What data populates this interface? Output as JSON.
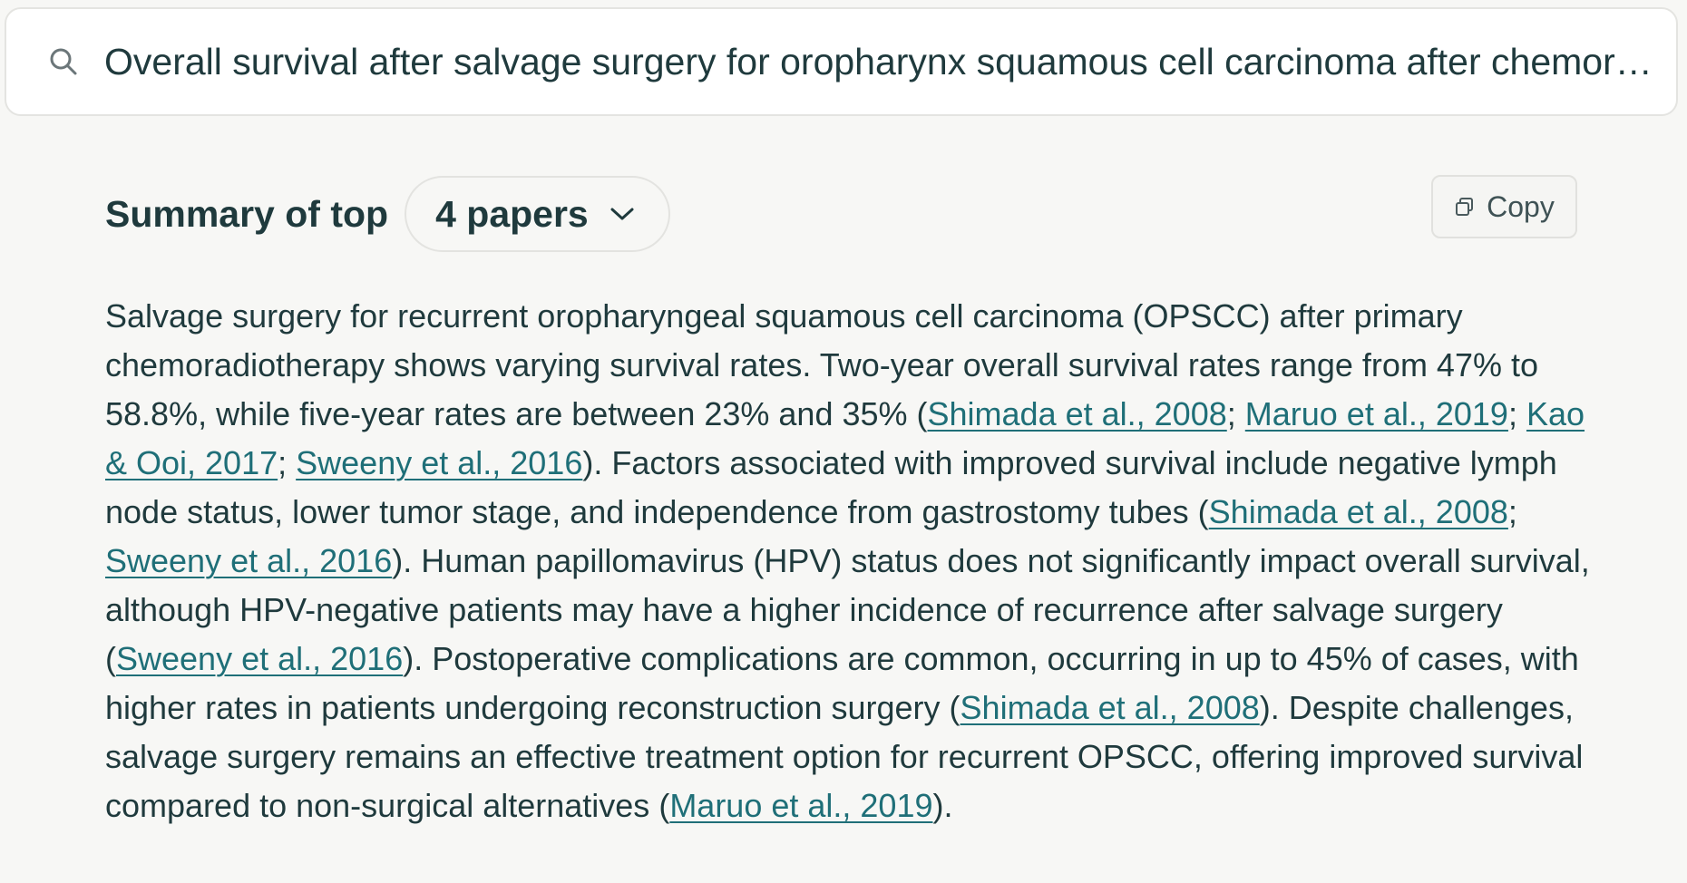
{
  "search": {
    "value": "Overall survival after salvage surgery for oropharynx squamous cell carcinoma after chemoradiotherapy",
    "placeholder": ""
  },
  "summary": {
    "title": "Summary of top",
    "papers_dropdown_label": "4 papers",
    "copy_label": "Copy",
    "body": {
      "p1": "Salvage surgery for recurrent oropharyngeal squamous cell carcinoma (OPSCC) after primary chemoradiotherapy shows varying survival rates. Two-year overall survival rates range from 47% to 58.8%, while five-year rates are between 23% and 35% (",
      "c1": "Shimada et al., 2008",
      "s1": "; ",
      "c2": "Maruo et al., 2019",
      "s2": "; ",
      "c3": "Kao & Ooi, 2017",
      "s3": "; ",
      "c4": "Sweeny et al., 2016",
      "p2": "). Factors associated with improved survival include negative lymph node status, lower tumor stage, and independence from gastrostomy tubes (",
      "c5": "Shimada et al., 2008",
      "s4": "; ",
      "c6": "Sweeny et al., 2016",
      "p3": "). Human papillomavirus (HPV) status does not significantly impact overall survival, although HPV-negative patients may have a higher incidence of recurrence after salvage surgery (",
      "c7": "Sweeny et al., 2016",
      "p4": "). Postoperative complications are common, occurring in up to 45% of cases, with higher rates in patients undergoing reconstruction surgery (",
      "c8": "Shimada et al., 2008",
      "p5": "). Despite challenges, salvage surgery remains an effective treatment option for recurrent OPSCC, offering improved survival compared to non-surgical alternatives (",
      "c9": "Maruo et al., 2019",
      "p6": ")."
    }
  },
  "icons": {
    "search": "search-icon",
    "chevron": "chevron-down-icon",
    "copy": "copy-icon"
  },
  "colors": {
    "background": "#f7f7f5",
    "text": "#1f3a3d",
    "link": "#1f6f78",
    "border": "#e4e4e1"
  }
}
